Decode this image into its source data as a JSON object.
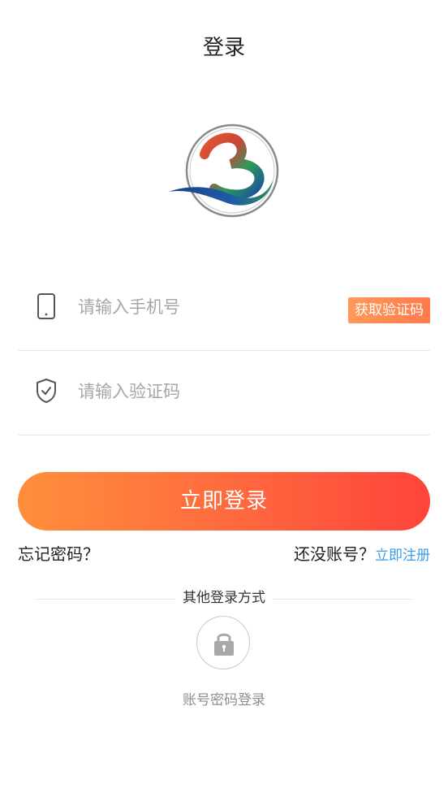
{
  "header": {
    "title": "登录"
  },
  "logo": {
    "icon": "b-heart-logo"
  },
  "phone": {
    "placeholder": "请输入手机号",
    "value": "",
    "icon": "phone-icon",
    "get_code_label": "获取验证码"
  },
  "code": {
    "placeholder": "请输入验证码",
    "value": "",
    "icon": "shield-check-icon"
  },
  "login": {
    "label": "立即登录"
  },
  "links": {
    "forgot": "忘记密码？",
    "no_account": "还没账号？",
    "register": "立即注册"
  },
  "other": {
    "label": "其他登录方式",
    "methods": [
      {
        "label": "账号密码登录",
        "icon": "lock-icon"
      }
    ]
  },
  "colors": {
    "accent_start": "#ff8f3b",
    "accent_end": "#ff443b",
    "link": "#3a9bea",
    "get_code": "#ff8a50"
  }
}
